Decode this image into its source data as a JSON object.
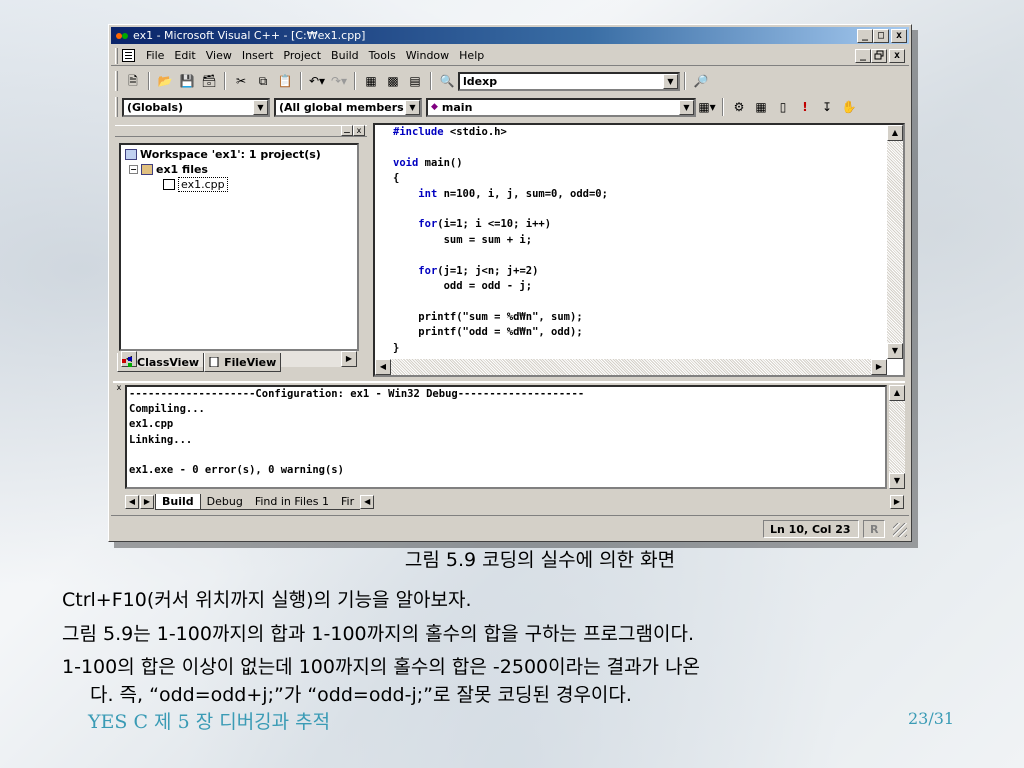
{
  "window": {
    "title": "ex1 - Microsoft Visual C++ - [C:₩ex1.cpp]",
    "title_buttons": [
      "_",
      "□",
      "x"
    ],
    "mdi_buttons": [
      "_",
      " ",
      "x"
    ]
  },
  "menu": {
    "items": [
      "File",
      "Edit",
      "View",
      "Insert",
      "Project",
      "Build",
      "Tools",
      "Window",
      "Help"
    ]
  },
  "toolbar1": {
    "find_combo_value": "ldexp"
  },
  "toolbar2": {
    "scope_combo": "(Globals)",
    "members_combo": "(All global members",
    "function_combo": "main"
  },
  "workspace": {
    "root": "Workspace 'ex1': 1 project(s)",
    "project": "ex1 files",
    "file": "ex1.cpp",
    "tabs": [
      "ClassView",
      "FileView"
    ]
  },
  "editor": {
    "lines": [
      "#include <stdio.h>",
      "",
      "void main()",
      "{",
      "    int n=100, i, j, sum=0, odd=0;",
      "",
      "    for(i=1; i <=10; i++)",
      "        sum = sum + i;",
      "",
      "    for(j=1; j<n; j+=2)",
      "        odd = odd - j;",
      "",
      "    printf(\"sum = %d₩n\", sum);",
      "    printf(\"odd = %d₩n\", odd);",
      "}"
    ]
  },
  "output": {
    "lines": [
      "--------------------Configuration: ex1 - Win32 Debug--------------------",
      "Compiling...",
      "ex1.cpp",
      "Linking...",
      "",
      "ex1.exe - 0 error(s), 0 warning(s)"
    ],
    "tabs": [
      "Build",
      "Debug",
      "Find in Files 1",
      "Fir"
    ]
  },
  "status": {
    "position": "Ln 10, Col 23",
    "mode": "R"
  },
  "slide": {
    "caption": "그림 5.9 코딩의 실수에 의한 화면",
    "line1": "Ctrl+F10(커서 위치까지 실행)의 기능을 알아보자.",
    "line2": "그림 5.9는 1-100까지의 합과 1-100까지의 홀수의 합을 구하는 프로그램이다.",
    "line3a": "1-100의 합은 이상이 없는데 100까지의 홀수의 합은 -2500이라는 결과가 나온",
    "line3b": "다. 즉, “odd=odd+j;”가 “odd=odd-j;”로 잘못 코딩된 경우이다.",
    "footer_left": "YES C  제 5 장 디버깅과 추적",
    "footer_right": "23/31"
  }
}
